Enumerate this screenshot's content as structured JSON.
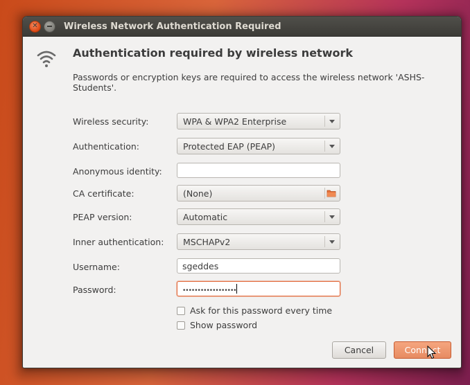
{
  "window": {
    "title": "Wireless Network Authentication Required"
  },
  "dialog": {
    "heading": "Authentication required by wireless network",
    "description": "Passwords or encryption keys are required to access the wireless network 'ASHS-Students'.",
    "icon": "wifi-icon"
  },
  "form": {
    "wireless_security": {
      "label": "Wireless security:",
      "value": "WPA & WPA2 Enterprise"
    },
    "authentication": {
      "label": "Authentication:",
      "value": "Protected EAP (PEAP)"
    },
    "anonymous_identity": {
      "label": "Anonymous identity:",
      "value": ""
    },
    "ca_certificate": {
      "label": "CA certificate:",
      "value": "(None)"
    },
    "peap_version": {
      "label": "PEAP version:",
      "value": "Automatic"
    },
    "inner_authentication": {
      "label": "Inner authentication:",
      "value": "MSCHAPv2"
    },
    "username": {
      "label": "Username:",
      "value": "sgeddes"
    },
    "password": {
      "label": "Password:",
      "value": "••••••••••••••••••"
    },
    "ask_password": {
      "label": "Ask for this password every time",
      "checked": false
    },
    "show_password": {
      "label": "Show password",
      "checked": false
    }
  },
  "buttons": {
    "cancel": "Cancel",
    "connect": "Connect"
  },
  "colors": {
    "accent": "#dd4814",
    "titlebar": "#3c3b37",
    "dialog_bg": "#f2f1f0"
  }
}
